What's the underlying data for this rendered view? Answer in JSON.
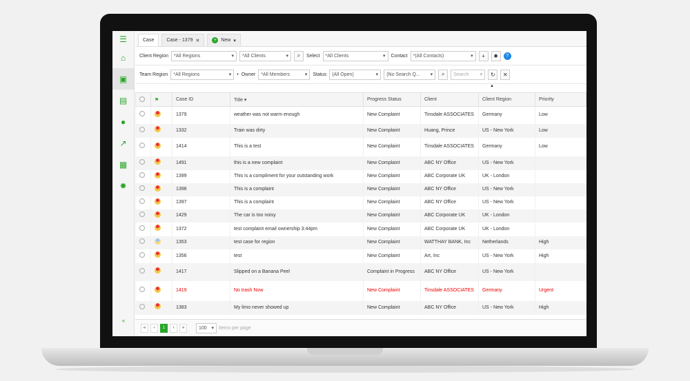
{
  "tabs": [
    "Case",
    "Case - 1379",
    "New"
  ],
  "filters1": {
    "client_region_label": "Client Region",
    "client_region": "*All Regions",
    "clients": "*All Clients",
    "select_label": "Select",
    "select_value": "*All Clients",
    "contact_label": "Contact",
    "contact_value": "*(All Contacts)"
  },
  "filters2": {
    "team_region_label": "Team Region",
    "team_region": "*All Regions",
    "owner_label": "Owner",
    "owner_value": "*All Members",
    "status_label": "Status",
    "status_value": "(All Open)",
    "search_query": "(No Search Q...",
    "search_placeholder": "Search"
  },
  "columns": [
    "Case ID",
    "Title ▾",
    "Progress Status",
    "Client",
    "Client Region",
    "Priority"
  ],
  "rows": [
    {
      "id": "1379",
      "title": "weather was not warm enough",
      "status": "New Complaint",
      "client": "Tinsdale ASSOCIATES",
      "region": "Germany",
      "priority": "Low"
    },
    {
      "id": "1332",
      "title": "Train was dirty",
      "status": "New Complaint",
      "client": "Huang, Prince",
      "region": "US - New York",
      "priority": "Low"
    },
    {
      "id": "1414",
      "title": "This is a test",
      "status": "New Complaint",
      "client": "Tinsdale ASSOCIATES",
      "region": "Germany",
      "priority": "Low"
    },
    {
      "id": "1491",
      "title": "this is a new complaint",
      "status": "New Complaint",
      "client": "ABC NY Office",
      "region": "US - New York",
      "priority": ""
    },
    {
      "id": "1399",
      "title": "This is a compliment for your outstanding work",
      "status": "New Complaint",
      "client": "ABC Corporate UK",
      "region": "UK - London",
      "priority": ""
    },
    {
      "id": "1398",
      "title": "This is a complaint",
      "status": "New Complaint",
      "client": "ABC NY Office",
      "region": "US - New York",
      "priority": ""
    },
    {
      "id": "1397",
      "title": "This is a complaint",
      "status": "New Complaint",
      "client": "ABC NY Office",
      "region": "US - New York",
      "priority": ""
    },
    {
      "id": "1429",
      "title": "The car is too noisy",
      "status": "New Complaint",
      "client": "ABC Corporate UK",
      "region": "UK - London",
      "priority": ""
    },
    {
      "id": "1372",
      "title": "test complaint email ownership 3:44pm",
      "status": "New Complaint",
      "client": "ABC Corporate UK",
      "region": "UK - London",
      "priority": ""
    },
    {
      "id": "1353",
      "title": "test case for region",
      "status": "New Complaint",
      "client": "WATTHAY BANK, Inc",
      "region": "Netherlands",
      "priority": "High"
    },
    {
      "id": "1356",
      "title": "test",
      "status": "New Complaint",
      "client": "Art, Inc",
      "region": "US - New York",
      "priority": "High"
    },
    {
      "id": "1417",
      "title": "Slipped on a Banana Peel",
      "status": "Complaint in Progress",
      "client": "ABC NY Office",
      "region": "US - New York",
      "priority": ""
    },
    {
      "id": "1419",
      "title": "No trash Now",
      "status": "New Complaint",
      "client": "Tinsdale ASSOCIATES",
      "region": "Germany",
      "priority": "Urgent",
      "urgent": true
    },
    {
      "id": "1383",
      "title": "My limo never showed up",
      "status": "New Complaint",
      "client": "ABC NY Office",
      "region": "US - New York",
      "priority": "High"
    }
  ],
  "pager": {
    "page": "1",
    "per_page": "100",
    "per_page_label": "Items per page"
  },
  "colors": {
    "accent": "#2aa52a",
    "urgent": "#ee0000"
  }
}
